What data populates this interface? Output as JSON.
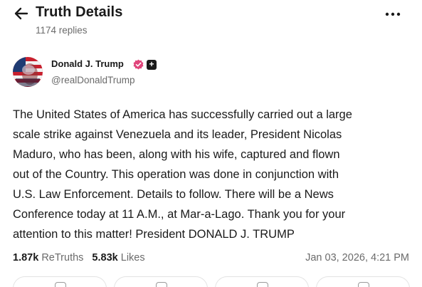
{
  "header": {
    "title": "Truth Details",
    "replies": "1174 replies",
    "back_icon": "arrow-left-icon",
    "more_icon": "more-horizontal-icon"
  },
  "author": {
    "name": "Donald J. Trump",
    "handle": "@realDonaldTrump",
    "verified_icon": "verified-badge-icon",
    "plus_badge": "+"
  },
  "post": {
    "lines": [
      "The United States of America has successfully carried out a large",
      "scale strike against Venezuela and its leader, President Nicolas",
      "Maduro, who has been, along with his wife, captured and flown",
      "out of the Country. This operation was done in conjunction with",
      "U.S. Law Enforcement. Details to follow. There will be a News",
      "Conference today at 11 A.M., at Mar-a-Lago. Thank you for your",
      "attention to this matter! President DONALD J. TRUMP"
    ]
  },
  "stats": {
    "retruths_count": "1.87k",
    "retruths_label": "ReTruths",
    "likes_count": "5.83k",
    "likes_label": "Likes",
    "timestamp": "Jan 03, 2026, 4:21 PM"
  },
  "actions": [
    {
      "icon": "reply-icon"
    },
    {
      "icon": "retruth-icon"
    },
    {
      "icon": "like-icon"
    },
    {
      "icon": "share-icon"
    }
  ],
  "colors": {
    "text": "#1a1a1a",
    "muted": "#6b6b6b",
    "verified": "#e0457b",
    "border": "#e3e3e3"
  }
}
